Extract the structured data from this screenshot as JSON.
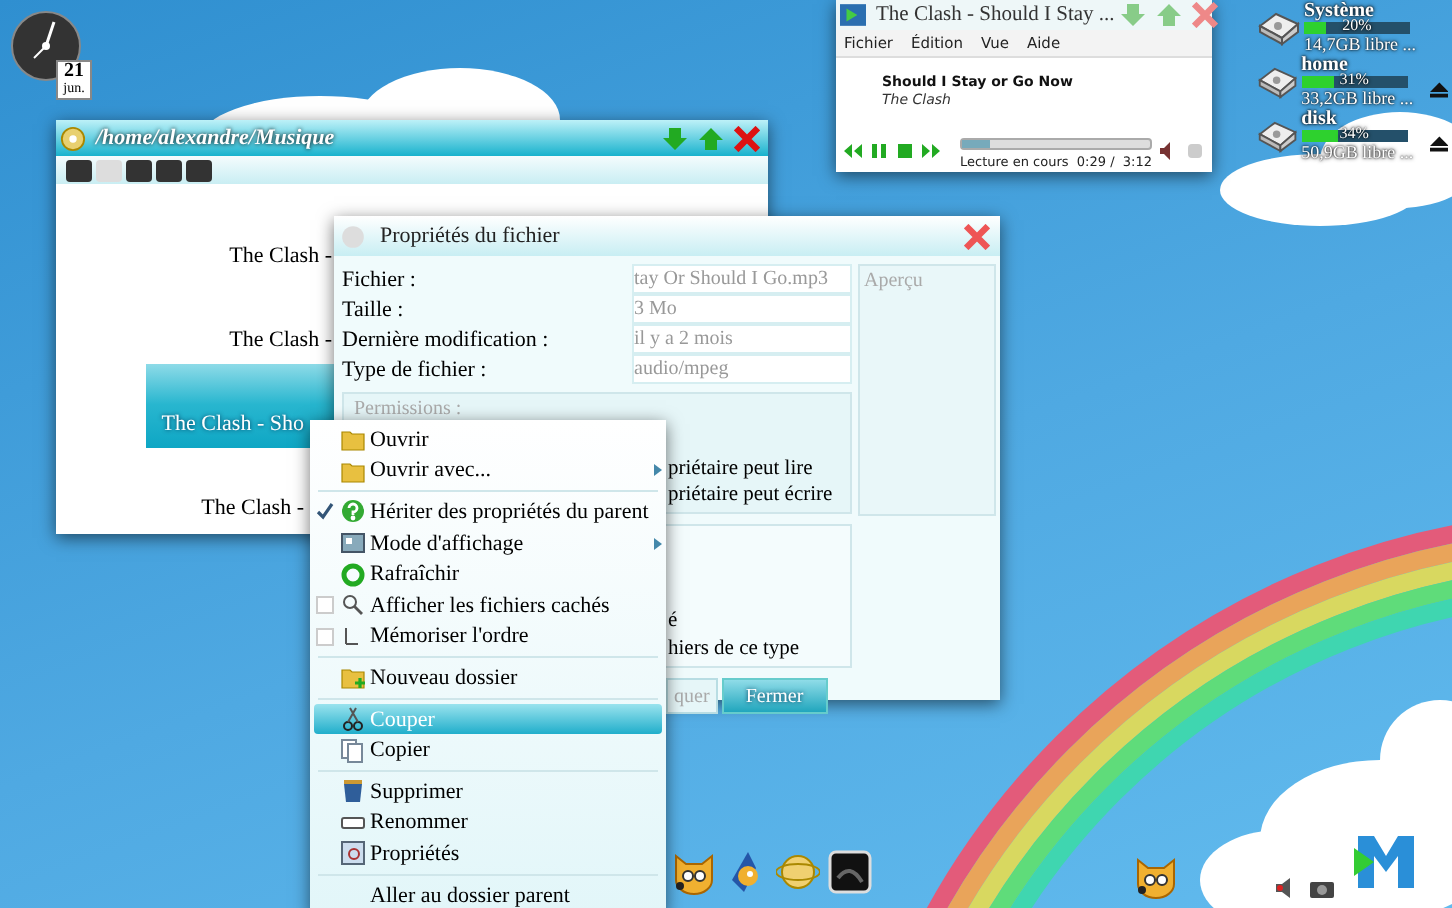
{
  "clock": {
    "day": "21",
    "month": "jun."
  },
  "file_manager": {
    "title": "/home/alexandre/Musique",
    "items": [
      {
        "label": "The Clash -",
        "selected": false
      },
      {
        "label": "The Clash -",
        "selected": false
      },
      {
        "label": "The Clash - Sho",
        "selected": true
      },
      {
        "label": "The Clash -",
        "selected": false
      }
    ]
  },
  "properties_dialog": {
    "title": "Propriétés du fichier",
    "fields": [
      {
        "label": "Fichier :",
        "value": "tay Or Should I Go.mp3"
      },
      {
        "label": "Taille :",
        "value": "3 Mo"
      },
      {
        "label": "Dernière modification :",
        "value": "il y a 2 mois"
      },
      {
        "label": "Type de fichier :",
        "value": "audio/mpeg"
      }
    ],
    "preview_title": "Aperçu",
    "permissions": {
      "title": "Permissions :",
      "rows": [
        "priétaire peut lire",
        "priétaire peut écrire"
      ]
    },
    "group_2_rows": [
      "é",
      "hiers de ce type"
    ],
    "buttons": [
      {
        "label": "quer",
        "primary": false
      },
      {
        "label": "Fermer",
        "primary": true
      }
    ]
  },
  "context_menu": {
    "groups": [
      [
        {
          "label": "Ouvrir",
          "kind": "action",
          "selected": false
        },
        {
          "label": "Ouvrir avec...",
          "kind": "submenu",
          "selected": false
        }
      ],
      [
        {
          "label": "Hériter des propriétés du parent",
          "kind": "check",
          "checked": true,
          "selected": false
        },
        {
          "label": "Mode d'affichage",
          "kind": "submenu",
          "selected": false
        },
        {
          "label": "Rafraîchir",
          "kind": "action",
          "selected": false
        },
        {
          "label": "Afficher les fichiers cachés",
          "kind": "check",
          "checked": false,
          "selected": false
        },
        {
          "label": "Mémoriser l'ordre",
          "kind": "check",
          "checked": false,
          "selected": false
        }
      ],
      [
        {
          "label": "Nouveau dossier",
          "kind": "action",
          "selected": false
        }
      ],
      [
        {
          "label": "Couper",
          "kind": "action",
          "selected": true
        },
        {
          "label": "Copier",
          "kind": "action",
          "selected": false
        }
      ],
      [
        {
          "label": "Supprimer",
          "kind": "action",
          "selected": false
        },
        {
          "label": "Renommer",
          "kind": "action",
          "selected": false
        },
        {
          "label": "Propriétés",
          "kind": "action",
          "selected": false
        }
      ],
      [
        {
          "label": "Aller au dossier parent",
          "kind": "action",
          "selected": false
        }
      ]
    ]
  },
  "media_player": {
    "title": "The Clash - Should I Stay ...",
    "menu": [
      "Fichier",
      "Édition",
      "Vue",
      "Aide"
    ],
    "track": "Should I Stay or Go Now",
    "artist": "The Clash",
    "status": "Lecture en cours",
    "time": "0:29 /  3:12",
    "seek": {
      "level": 0.15
    }
  },
  "drives": [
    {
      "name": "Système",
      "percent": "20%",
      "level": 0.2,
      "free": "14,7GB libre ...",
      "ejectable": false
    },
    {
      "name": "home",
      "percent": "31%",
      "level": 0.31,
      "free": "33,2GB libre ...",
      "ejectable": true
    },
    {
      "name": "disk",
      "percent": "34%",
      "level": 0.34,
      "free": "50,9GB libre ...",
      "ejectable": true
    }
  ]
}
